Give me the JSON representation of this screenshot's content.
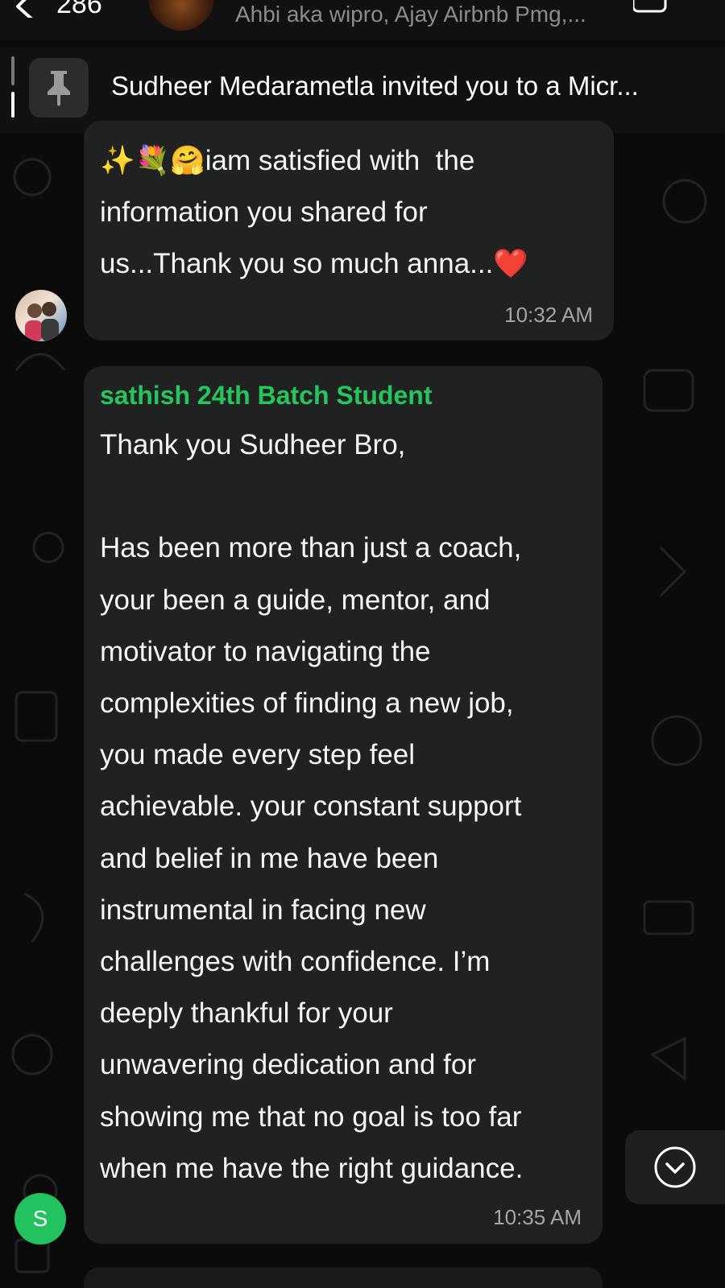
{
  "header": {
    "back_count": "286",
    "members": "Ahbi aka wipro, Ajay Airbnb Pmg,..."
  },
  "pinned": {
    "text": "Sudheer Medarametla invited you to a Micr..."
  },
  "messages": [
    {
      "emoji_prefix": "✨💐🤗",
      "text": "iam satisfied with  the\ninformation you shared for\nus...Thank you so much anna...",
      "emoji_suffix": "❤️",
      "time": "10:32 AM"
    },
    {
      "sender": "sathish 24th Batch Student",
      "text": "Thank you Sudheer Bro,\n\nHas been more than just a coach,\nyour been a guide, mentor, and\nmotivator to navigating the\ncomplexities of finding a new job,\nyou made every step feel\nachievable. your constant support\nand belief in me have been\ninstrumental in facing new\nchallenges with confidence. I’m\ndeeply thankful for your\nunwavering dedication and for\nshowing me that no goal is too far\nwhen me have the right guidance.",
      "time": "10:35 AM",
      "avatar_initial": "S"
    }
  ],
  "colors": {
    "sender_name": "#25c45d",
    "bubble": "#202121",
    "background": "#0b0b0b"
  }
}
